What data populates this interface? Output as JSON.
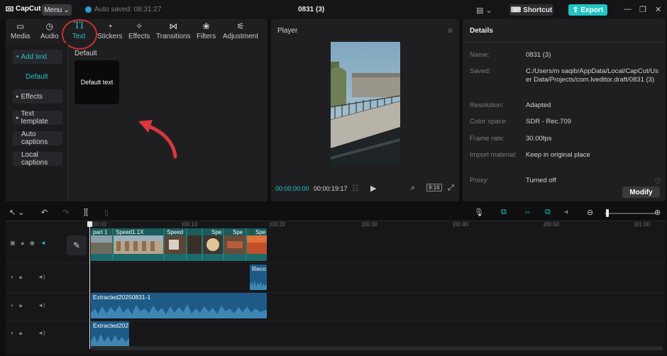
{
  "titlebar": {
    "logo": "CapCut",
    "menu_label": "Menu",
    "autosave_text": "Auto saved: 08:31:27",
    "window_title": "0831 (3)",
    "shortcut_label": "Shortcut",
    "export_label": "Export"
  },
  "tabs": [
    {
      "label": "Media",
      "icon": "media-icon"
    },
    {
      "label": "Audio",
      "icon": "audio-icon"
    },
    {
      "label": "Text",
      "icon": "text-icon",
      "glyph": "TI"
    },
    {
      "label": "Stickers",
      "icon": "stickers-icon"
    },
    {
      "label": "Effects",
      "icon": "effects-icon"
    },
    {
      "label": "Transitions",
      "icon": "transitions-icon"
    },
    {
      "label": "Filters",
      "icon": "filters-icon"
    },
    {
      "label": "Adjustment",
      "icon": "adjustment-icon"
    }
  ],
  "left_nav": {
    "add_text": "Add text",
    "default": "Default",
    "effects": "Effects",
    "text_template": "Text template",
    "auto_captions": "Auto captions",
    "local_captions": "Local captions"
  },
  "content": {
    "section_title": "Default",
    "card_label": "Default text"
  },
  "player": {
    "title": "Player",
    "current_time": "00:00:00:00",
    "total_time": "00:00:19:17",
    "ratio": "9:16"
  },
  "details": {
    "title": "Details",
    "rows": [
      {
        "label": "Name:",
        "value": "0831 (3)"
      },
      {
        "label": "Saved:",
        "value": "C:/Users/m saqib/AppData/Local/CapCut/User Data/Projects/com.lveditor.draft/0831 (3)"
      },
      {
        "label": "Resolution:",
        "value": "Adapted"
      },
      {
        "label": "Color space:",
        "value": "SDR - Rec.709"
      },
      {
        "label": "Frame rate:",
        "value": "30.00fps"
      },
      {
        "label": "Import material:",
        "value": "Keep in original place"
      },
      {
        "label": "Proxy:",
        "value": "Turned off"
      }
    ],
    "modify_label": "Modify"
  },
  "timeline": {
    "ruler": [
      "00:00",
      "|00:10",
      "|00:20",
      "|00:30",
      "|00:40",
      "|00:50",
      "|01:00"
    ],
    "video_clip_labels": [
      "part 1",
      "Speed1.1X",
      "Speed",
      "Spe",
      "Spe",
      "Spe"
    ],
    "record_clip_label": "Reco",
    "audio_clip_1": "Extracted20250831-1",
    "audio_clip_2": "Extracted202"
  }
}
